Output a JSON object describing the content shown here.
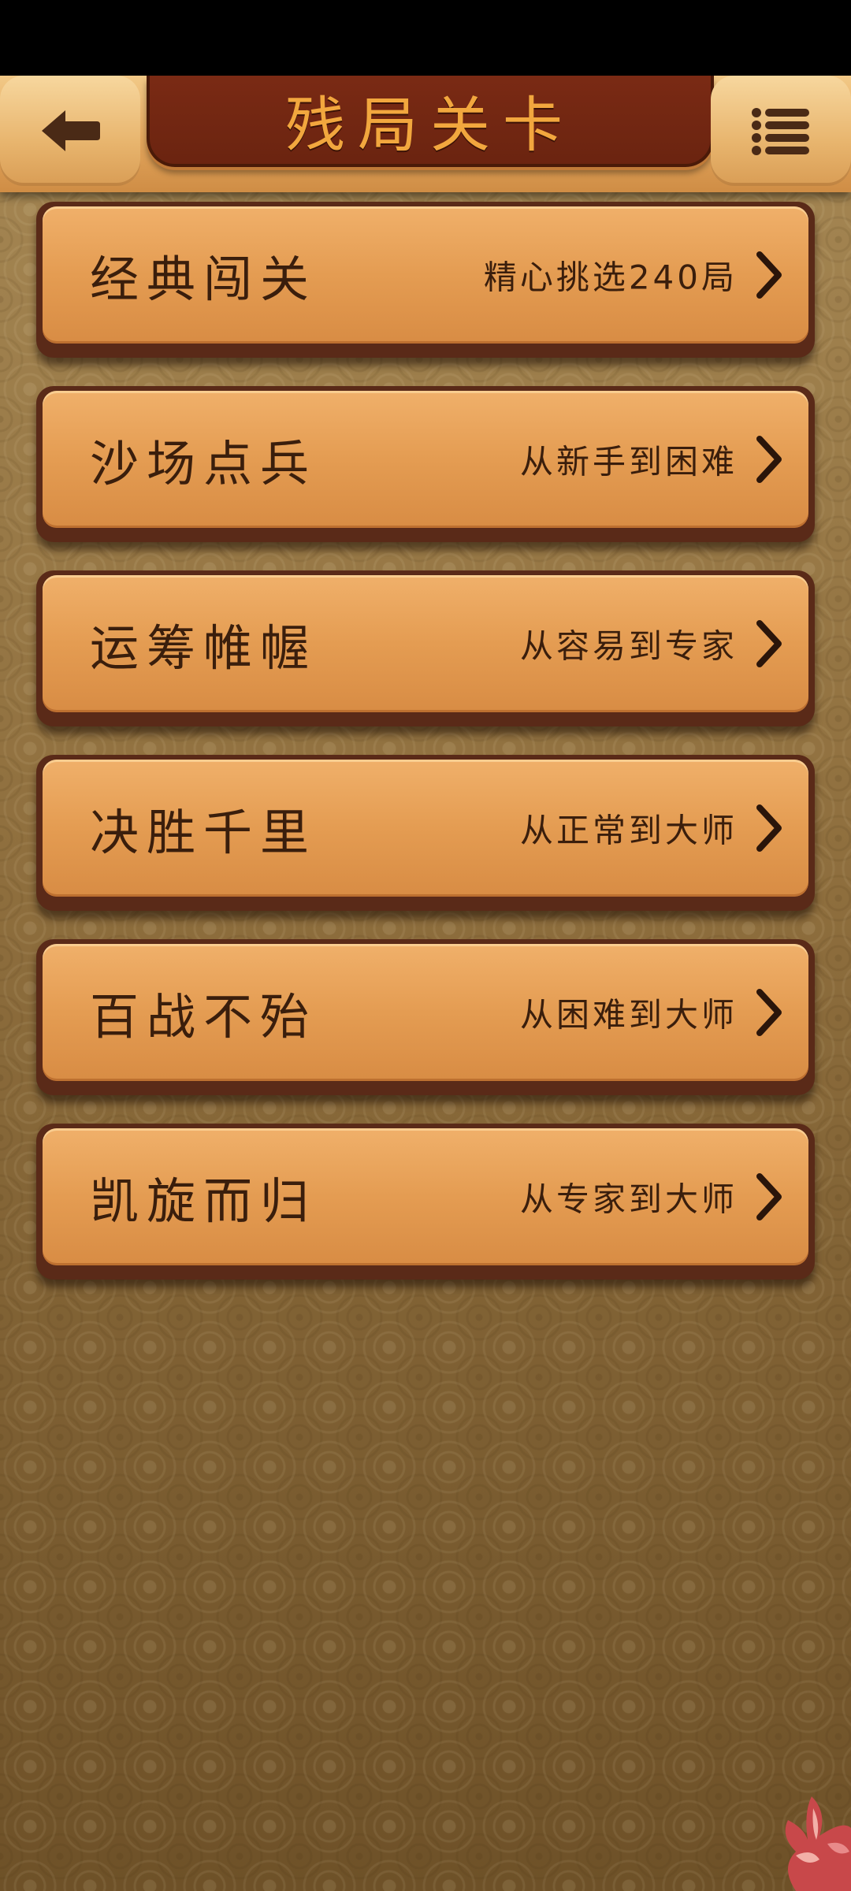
{
  "header": {
    "title": "残局关卡",
    "back_icon": "back-arrow-icon",
    "menu_icon": "list-menu-icon"
  },
  "levels": [
    {
      "name": "经典闯关",
      "desc": "精心挑选240局"
    },
    {
      "name": "沙场点兵",
      "desc": "从新手到困难"
    },
    {
      "name": "运筹帷幄",
      "desc": "从容易到专家"
    },
    {
      "name": "决胜千里",
      "desc": "从正常到大师"
    },
    {
      "name": "百战不殆",
      "desc": "从困难到大师"
    },
    {
      "name": "凯旋而归",
      "desc": "从专家到大师"
    }
  ],
  "colors": {
    "title": "#f2a73e",
    "title_plate": "#6b2410",
    "item_face": "#e49c52",
    "item_text": "#3a1e0c"
  }
}
